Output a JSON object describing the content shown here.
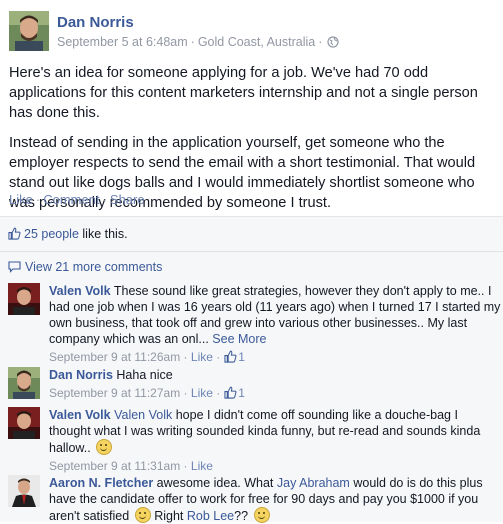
{
  "post": {
    "author": "Dan Norris",
    "date": "September 5 at 6:48am",
    "location": "Gold Coast, Australia",
    "privacy_icon": "globe-icon",
    "paragraph1": "Here's an idea for someone applying for a job. We've had 70 odd applications for this content marketers internship and not a single person has done this.",
    "paragraph2": "Instead of sending in the application yourself, get someone who the employer respects to send the email with a short testimonial. That would stand out like dogs balls and I would immediately shortlist someone who was personally recommended by someone I trust.",
    "actions": {
      "like": "Like",
      "comment": "Comment",
      "share": "Share",
      "separator": "·"
    }
  },
  "feedback": {
    "likes_count": "25 people",
    "likes_suffix": "like this.",
    "view_more": "View 21 more comments"
  },
  "comments": [
    {
      "author": "Valen Volk",
      "text": "These sound like great strategies, however they don't apply to me.. I had one job when I was 16 years old (11 years ago) when I turned 17 I started my own business, that took off and grew into various other businesses.. My last company which was an onl...",
      "see_more": "See More",
      "date": "September 9 at 11:26am",
      "like_label": "Like",
      "like_count": "1"
    },
    {
      "author": "Dan Norris",
      "text": "Haha nice",
      "date": "September 9 at 11:27am",
      "like_label": "Like",
      "like_count": "1"
    },
    {
      "author": "Valen Volk",
      "mention": "Valen Volk",
      "text": "hope I didn't come off sounding like a douche-bag I thought what I was writing sounded kinda funny, but re-read and sounds kinda hallow..",
      "date": "September 9 at 11:31am",
      "like_label": "Like"
    },
    {
      "author": "Aaron N. Fletcher",
      "text_a": "awesome idea. What",
      "mention_a": "Jay Abraham",
      "text_b": "would do is do this plus have the candidate offer to work for free for 90 days and pay you $1000 if you aren't satisfied",
      "text_c": "Right",
      "mention_b": "Rob Lee",
      "text_d": "??"
    }
  ],
  "colors": {
    "link": "#3b5998",
    "meta": "#9197a3",
    "feedback_bg": "#f6f7f9"
  }
}
